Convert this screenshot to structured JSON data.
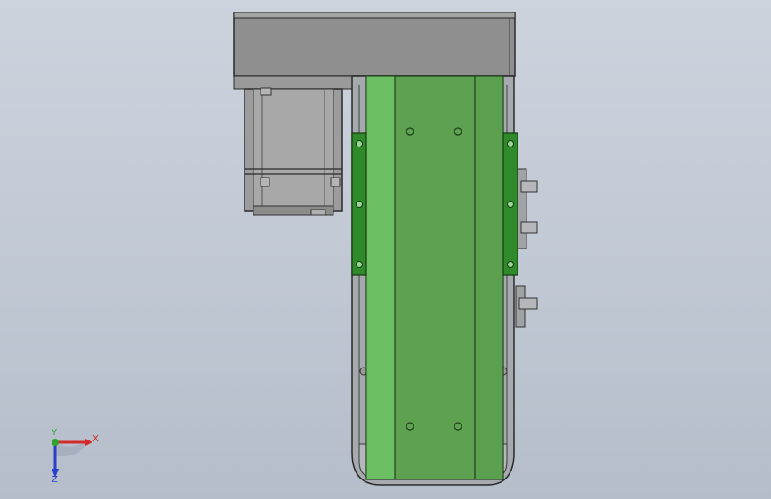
{
  "triad": {
    "x_label": "X",
    "y_label": "Y",
    "z_label": "Z"
  },
  "colors": {
    "background_top": "#cdd3dd",
    "background_bottom": "#b5bdca",
    "motor_cover": "#8f8f8f",
    "motor_body": "#9a9a9a",
    "frame": "#a6a9ad",
    "belt_green": "#5ea150",
    "belt_light_green": "#6cc063",
    "bracket_green": "#2f8a2a",
    "axis_x": "#d42a2a",
    "axis_y": "#2fa12f",
    "axis_z": "#2b3fc9"
  }
}
